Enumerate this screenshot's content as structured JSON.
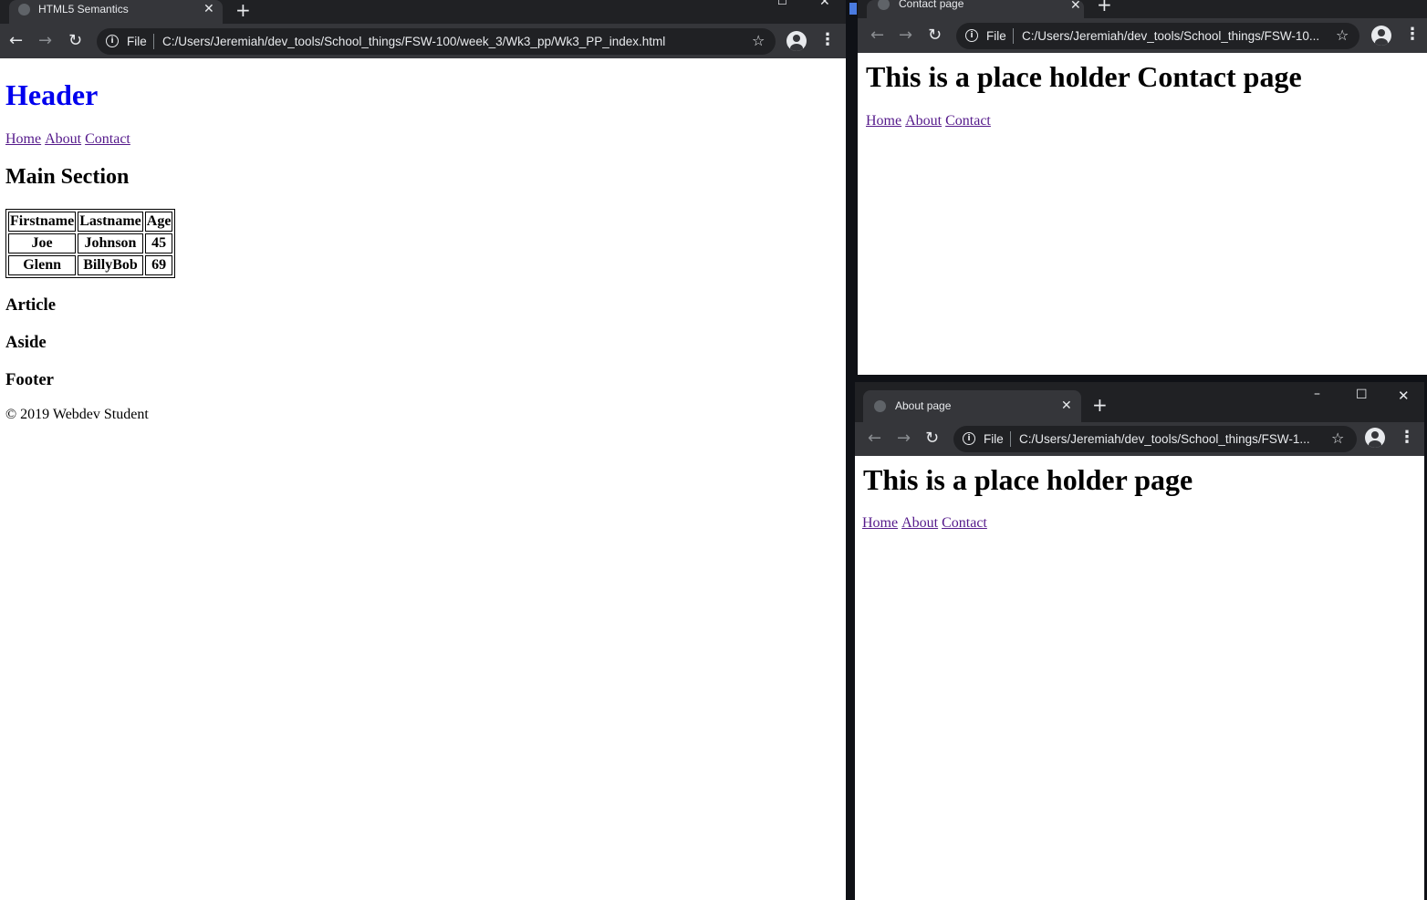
{
  "windows": {
    "main": {
      "tab_title": "HTML5 Semantics",
      "file_label": "File",
      "url": "C:/Users/Jeremiah/dev_tools/School_things/FSW-100/week_3/Wk3_pp/Wk3_PP_index.html",
      "page": {
        "header": "Header",
        "nav": [
          "Home",
          "About",
          "Contact"
        ],
        "main_heading": "Main Section",
        "table": {
          "headers": [
            "Firstname",
            "Lastname",
            "Age"
          ],
          "rows": [
            [
              "Joe",
              "Johnson",
              "45"
            ],
            [
              "Glenn",
              "BillyBob",
              "69"
            ]
          ]
        },
        "article": "Article",
        "aside": "Aside",
        "footer": "Footer",
        "copyright": "© 2019 Webdev Student"
      }
    },
    "contact": {
      "tab_title": "Contact page",
      "file_label": "File",
      "url": "C:/Users/Jeremiah/dev_tools/School_things/FSW-10...",
      "page": {
        "heading": "This is a place holder Contact page",
        "nav": [
          "Home",
          "About",
          "Contact"
        ]
      }
    },
    "about": {
      "tab_title": "About page",
      "file_label": "File",
      "url": "C:/Users/Jeremiah/dev_tools/School_things/FSW-1...",
      "page": {
        "heading": "This is a place holder page",
        "nav": [
          "Home",
          "About",
          "Contact"
        ]
      }
    }
  },
  "icons": {
    "back": "arrow-left",
    "forward": "arrow-right",
    "reload": "reload",
    "info": "info",
    "star": "bookmark-star",
    "profile": "account-circle",
    "menu": "three-dot-menu",
    "close": "x",
    "new_tab": "plus"
  },
  "colors": {
    "chrome_dark": "#202124",
    "chrome_toolbar": "#35363a",
    "header_link_blue": "#0000ee",
    "visited_link": "#551a8b"
  }
}
